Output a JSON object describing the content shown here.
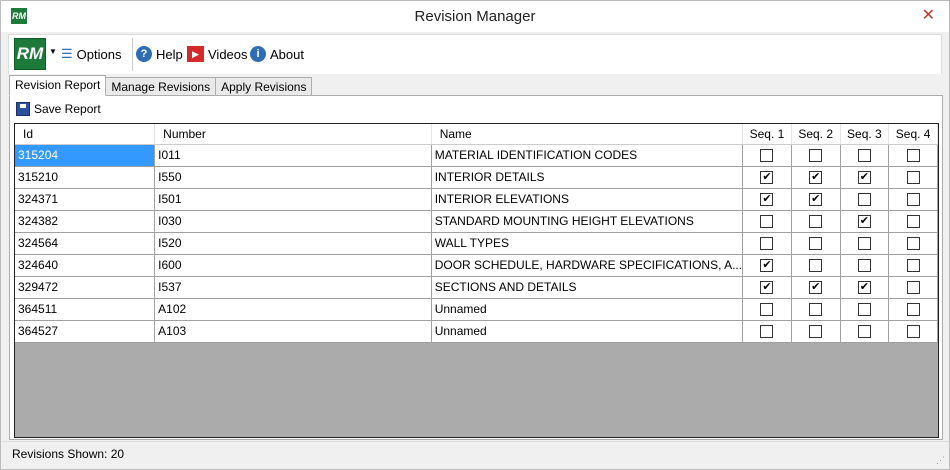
{
  "window": {
    "title": "Revision Manager",
    "close": "✕",
    "logo": "RM"
  },
  "toolbar": {
    "options": "Options",
    "help": "Help",
    "videos": "Videos",
    "about": "About"
  },
  "tabs": [
    "Revision Report",
    "Manage Revisions",
    "Apply Revisions"
  ],
  "save_report": "Save Report",
  "grid": {
    "columns": [
      "Id",
      "Number",
      "Name",
      "Seq. 1",
      "Seq. 2",
      "Seq. 3",
      "Seq. 4"
    ],
    "rows": [
      {
        "id": "315204",
        "number": "I011",
        "name": "MATERIAL IDENTIFICATION CODES",
        "seq": [
          false,
          false,
          false,
          false
        ]
      },
      {
        "id": "315210",
        "number": "I550",
        "name": "INTERIOR DETAILS",
        "seq": [
          true,
          true,
          true,
          false
        ]
      },
      {
        "id": "324371",
        "number": "I501",
        "name": "INTERIOR ELEVATIONS",
        "seq": [
          true,
          true,
          false,
          false
        ]
      },
      {
        "id": "324382",
        "number": "I030",
        "name": "STANDARD MOUNTING HEIGHT ELEVATIONS",
        "seq": [
          false,
          false,
          true,
          false
        ]
      },
      {
        "id": "324564",
        "number": "I520",
        "name": "WALL TYPES",
        "seq": [
          false,
          false,
          false,
          false
        ]
      },
      {
        "id": "324640",
        "number": "I600",
        "name": "DOOR SCHEDULE, HARDWARE SPECIFICATIONS, A...",
        "seq": [
          true,
          false,
          false,
          false
        ]
      },
      {
        "id": "329472",
        "number": "I537",
        "name": "SECTIONS AND DETAILS",
        "seq": [
          true,
          true,
          true,
          false
        ]
      },
      {
        "id": "364511",
        "number": "A102",
        "name": "Unnamed",
        "seq": [
          false,
          false,
          false,
          false
        ]
      },
      {
        "id": "364527",
        "number": "A103",
        "name": "Unnamed",
        "seq": [
          false,
          false,
          false,
          false
        ]
      }
    ]
  },
  "status": "Revisions Shown: 20"
}
